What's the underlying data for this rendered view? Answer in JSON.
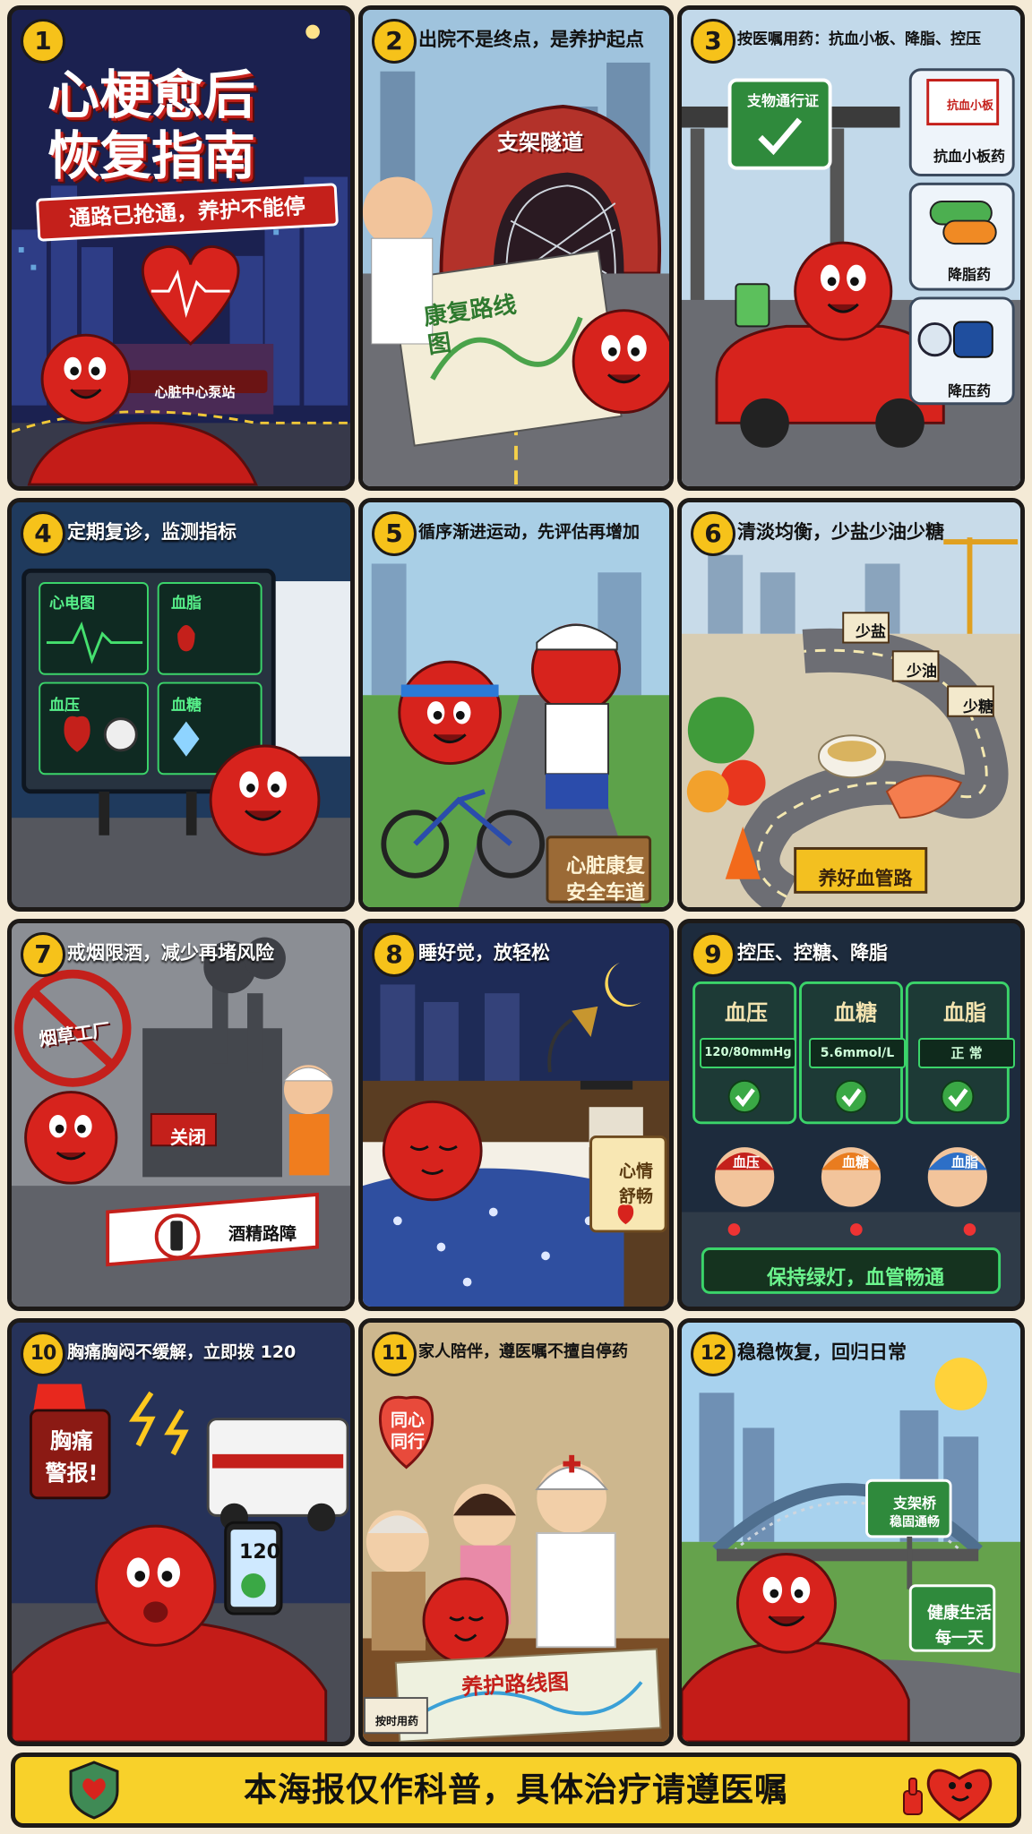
{
  "poster": {
    "title_line1": "心梗愈后",
    "title_line2": "恢复指南",
    "subtitle": "通路已抢通，养护不能停",
    "footer": "本海报仅作科普，具体治疗请遵医嘱"
  },
  "panels": [
    {
      "num": "1",
      "station": "心脏中心泵站"
    },
    {
      "num": "2",
      "title": "出院不是终点，是养护起点",
      "tunnel": "支架隧道",
      "map": "康复路线图"
    },
    {
      "num": "3",
      "title": "按医嘱用药：抗血小板、降脂、控压",
      "pass": "支物通行证",
      "meds": [
        {
          "label": "抗血小板药",
          "box": "抗血小板"
        },
        {
          "label": "降脂药"
        },
        {
          "label": "降压药"
        }
      ]
    },
    {
      "num": "4",
      "title": "定期复诊，监测指标",
      "screens": [
        "心电图",
        "血脂",
        "血压",
        "血糖"
      ]
    },
    {
      "num": "5",
      "title": "循序渐进运动，先评估再增加",
      "sign_line1": "心脏康复",
      "sign_line2": "安全车道"
    },
    {
      "num": "6",
      "title": "清淡均衡，少盐少油少糖",
      "signs": [
        "少盐",
        "少油",
        "少糖"
      ],
      "sign_main": "养好血管路"
    },
    {
      "num": "7",
      "title": "戒烟限酒，减少再堵风险",
      "factory": "烟草工厂",
      "closed": "关闭",
      "barrier": "酒精路障"
    },
    {
      "num": "8",
      "title": "睡好觉，放轻松",
      "card_line1": "心情",
      "card_line2": "舒畅"
    },
    {
      "num": "9",
      "title": "控压、控糖、降脂",
      "metrics": [
        {
          "name": "血压",
          "value": "120/80mmHg"
        },
        {
          "name": "血糖",
          "value": "5.6mmol/L"
        },
        {
          "name": "血脂",
          "value": "正 常"
        }
      ],
      "operators": [
        "血压",
        "血糖",
        "血脂"
      ],
      "console": "保持绿灯，血管畅通"
    },
    {
      "num": "10",
      "title": "胸痛胸闷不缓解，立即拨 120",
      "alarm_line1": "胸痛",
      "alarm_line2": "警报!",
      "phone": "120"
    },
    {
      "num": "11",
      "title": "家人陪伴，遵医嘱不擅自停药",
      "heart_line1": "同心",
      "heart_line2": "同行",
      "map": "养护路线图",
      "note": "按时用药"
    },
    {
      "num": "12",
      "title": "稳稳恢复，回归日常",
      "bridge_line1": "支架桥",
      "bridge_line2": "稳固通畅",
      "life_line1": "健康生活",
      "life_line2": "每一天"
    }
  ],
  "colors": {
    "badge": "#f6c21a",
    "hero_red": "#d7231d",
    "footer_bg": "#f8d12a",
    "ok_green": "#3aa845"
  }
}
